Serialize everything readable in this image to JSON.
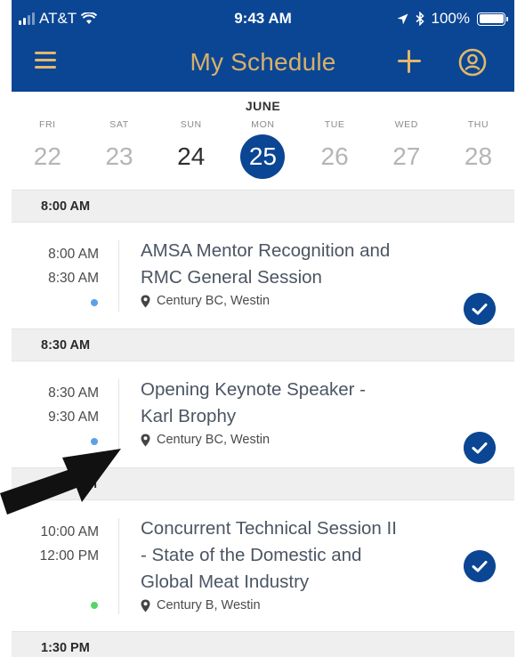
{
  "status_bar": {
    "carrier": "AT&T",
    "time": "9:43 AM",
    "battery": "100%"
  },
  "header": {
    "title": "My Schedule",
    "menu_icon": "hamburger-menu-icon",
    "add_icon": "plus-icon",
    "account_icon": "user-account-icon"
  },
  "calendar": {
    "month": "JUNE",
    "days": [
      {
        "dow": "FRI",
        "num": "22"
      },
      {
        "dow": "SAT",
        "num": "23"
      },
      {
        "dow": "SUN",
        "num": "24"
      },
      {
        "dow": "MON",
        "num": "25"
      },
      {
        "dow": "TUE",
        "num": "26"
      },
      {
        "dow": "WED",
        "num": "27"
      },
      {
        "dow": "THU",
        "num": "28"
      }
    ],
    "selected": "25"
  },
  "schedule": {
    "sections": [
      {
        "time": "8:00 AM"
      },
      {
        "time": "8:30 AM"
      },
      {
        "time": "10:00 AM"
      },
      {
        "time": "1:30 PM"
      }
    ],
    "events": [
      {
        "start": "8:00 AM",
        "end": "8:30 AM",
        "title_line1": "AMSA Mentor Recognition and",
        "title_line2": "RMC General Session",
        "location": "Century BC, Westin",
        "dot_color": "#5aa2e6"
      },
      {
        "start": "8:30 AM",
        "end": "9:30 AM",
        "title_line1": "Opening Keynote Speaker -",
        "title_line2": "Karl Brophy",
        "location": "Century BC, Westin",
        "dot_color": "#5aa2e6"
      },
      {
        "start": "10:00 AM",
        "end": "12:00 PM",
        "title_line1": "Concurrent Technical Session II",
        "title_line2": "- State of the Domestic and",
        "title_line3": "Global Meat Industry",
        "location": "Century B, Westin",
        "dot_color": "#57d36a"
      }
    ]
  },
  "colors": {
    "brand_blue": "#0b4694",
    "header_gold": "#d7b06a"
  }
}
